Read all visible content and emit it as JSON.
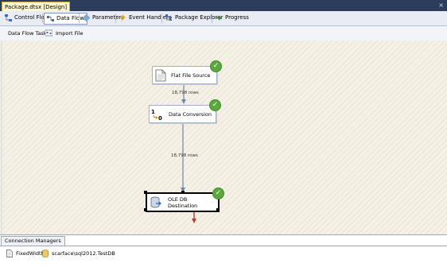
{
  "document": {
    "tab_title": "Package.dtsx [Design]",
    "close_glyph": "×"
  },
  "tabs": [
    {
      "label": "Control Flow",
      "icon": "control-flow-icon"
    },
    {
      "label": "Data Flow",
      "icon": "data-flow-icon",
      "active": true
    },
    {
      "label": "Parameters",
      "icon": "parameters-icon"
    },
    {
      "label": "Event Handlers",
      "icon": "event-handlers-icon"
    },
    {
      "label": "Package Explorer",
      "icon": "package-explorer-icon"
    },
    {
      "label": "Progress",
      "icon": "progress-icon"
    }
  ],
  "task_selector": {
    "label": "Data Flow Task:",
    "value": "Import File"
  },
  "components": [
    {
      "name": "Flat File Source",
      "status": "success"
    },
    {
      "name": "Data Conversion",
      "status": "success"
    },
    {
      "name": "OLE DB Destination",
      "status": "success",
      "selected": true
    }
  ],
  "paths": [
    {
      "rows_label": "18,798 rows"
    },
    {
      "rows_label": "18,798 rows"
    }
  ],
  "connection_managers": {
    "tab_label": "Connection Managers",
    "items": [
      {
        "name": "FixedWidth",
        "icon": "flat-file-connection-icon"
      },
      {
        "name": "scarface\\sql2012.TestDB",
        "icon": "oledb-connection-icon"
      }
    ]
  },
  "colors": {
    "title_bar": "#2b3d5b",
    "success": "#5aa83e",
    "path_line": "#6f87a8",
    "error_path": "#c0392b"
  }
}
